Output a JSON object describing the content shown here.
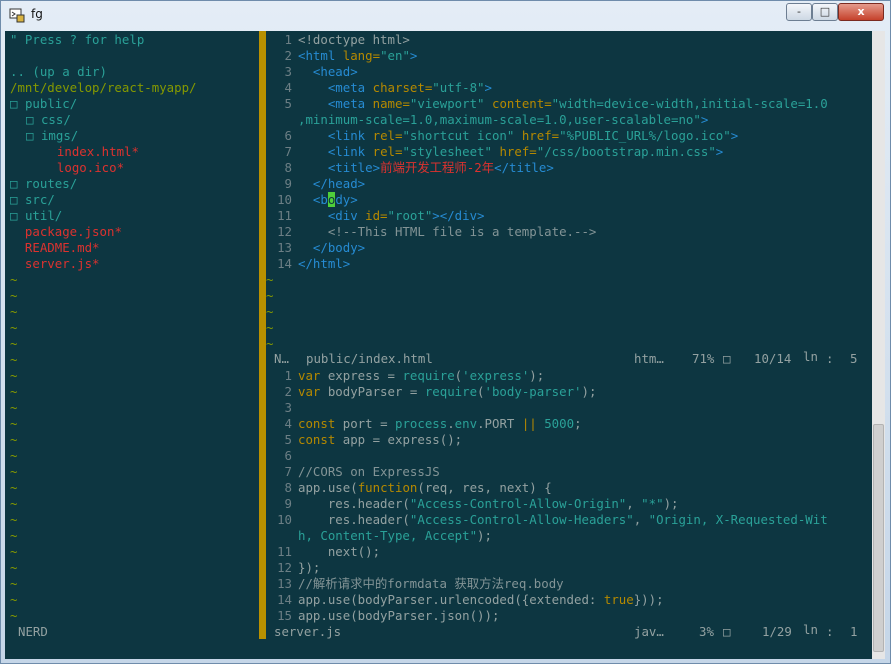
{
  "window": {
    "title": "fg",
    "buttons": [
      "-",
      "□",
      "x"
    ]
  },
  "icons": {
    "app": "terminal-tool-icon",
    "minimize": "minimize-icon",
    "maximize": "maximize-icon",
    "close": "close-icon"
  },
  "colors": {
    "background": "#0d3641",
    "tree_dir": "#2aa198",
    "tree_path": "#859900",
    "tree_file": "#dc322f",
    "separator": "#b89000",
    "text": "#93a1a1",
    "html_tag": "#268bd2",
    "string": "#2aa198",
    "keyword": "#b58900",
    "cursor": "#4fcf3a"
  },
  "nerdtree": {
    "help": "\" Press ? for help",
    "up": ".. (up a dir)",
    "path": "/mnt/develop/react-myapp/",
    "items": [
      {
        "indent": 0,
        "marker": "□",
        "name": "public/",
        "type": "dir"
      },
      {
        "indent": 1,
        "marker": "□",
        "name": "css/",
        "type": "dir"
      },
      {
        "indent": 1,
        "marker": "□",
        "name": "imgs/",
        "type": "dir"
      },
      {
        "indent": 2,
        "marker": "",
        "name": "index.html*",
        "type": "file"
      },
      {
        "indent": 2,
        "marker": "",
        "name": "logo.ico*",
        "type": "file"
      },
      {
        "indent": 0,
        "marker": "□",
        "name": "routes/",
        "type": "dir"
      },
      {
        "indent": 0,
        "marker": "□",
        "name": "src/",
        "type": "dir"
      },
      {
        "indent": 0,
        "marker": "□",
        "name": "util/",
        "type": "dir"
      },
      {
        "indent": 0,
        "marker": "",
        "name": "package.json*",
        "type": "file"
      },
      {
        "indent": 0,
        "marker": "",
        "name": "README.md*",
        "type": "file"
      },
      {
        "indent": 0,
        "marker": "",
        "name": "server.js*",
        "type": "file"
      }
    ],
    "tilde": "~",
    "statusline": "NERD"
  },
  "top_pane": {
    "lines": [
      {
        "n": "1",
        "segs": [
          [
            "<!doctype html>",
            "text"
          ]
        ]
      },
      {
        "n": "2",
        "segs": [
          [
            "<html ",
            "tag"
          ],
          [
            "lang=",
            "attr"
          ],
          [
            "\"en\"",
            "str"
          ],
          [
            ">",
            "tag"
          ]
        ]
      },
      {
        "n": "3",
        "segs": [
          [
            "  <head>",
            "tag"
          ]
        ]
      },
      {
        "n": "4",
        "segs": [
          [
            "    <meta ",
            "tag"
          ],
          [
            "charset=",
            "attr"
          ],
          [
            "\"utf-8\"",
            "str"
          ],
          [
            ">",
            "tag"
          ]
        ]
      },
      {
        "n": "5",
        "segs": [
          [
            "    <meta ",
            "tag"
          ],
          [
            "name=",
            "attr"
          ],
          [
            "\"viewport\" ",
            "str"
          ],
          [
            "content=",
            "attr"
          ],
          [
            "\"width=device-width,initial-scale=1.0",
            "str"
          ]
        ]
      },
      {
        "n": "",
        "segs": [
          [
            ",minimum-scale=1.0,maximum-scale=1.0,user-scalable=no\"",
            "str"
          ],
          [
            ">",
            "tag"
          ]
        ]
      },
      {
        "n": "6",
        "segs": [
          [
            "    <link ",
            "tag"
          ],
          [
            "rel=",
            "attr"
          ],
          [
            "\"shortcut icon\" ",
            "str"
          ],
          [
            "href=",
            "attr"
          ],
          [
            "\"%PUBLIC_URL%/logo.ico\"",
            "str"
          ],
          [
            ">",
            "tag"
          ]
        ]
      },
      {
        "n": "7",
        "segs": [
          [
            "    <link ",
            "tag"
          ],
          [
            "rel=",
            "attr"
          ],
          [
            "\"stylesheet\" ",
            "str"
          ],
          [
            "href=",
            "attr"
          ],
          [
            "\"/css/bootstrap.min.css\"",
            "str"
          ],
          [
            ">",
            "tag"
          ]
        ]
      },
      {
        "n": "8",
        "segs": [
          [
            "    <title>",
            "tag"
          ],
          [
            "前端开发工程师-2年",
            "red"
          ],
          [
            "</title>",
            "tag"
          ]
        ]
      },
      {
        "n": "9",
        "segs": [
          [
            "  </head>",
            "tag"
          ]
        ]
      },
      {
        "n": "10",
        "segs": [
          [
            "  <b",
            "tag"
          ],
          [
            "o",
            "cursor"
          ],
          [
            "dy>",
            "tag"
          ]
        ]
      },
      {
        "n": "11",
        "segs": [
          [
            "    <div ",
            "tag"
          ],
          [
            "id=",
            "attr"
          ],
          [
            "\"root\"",
            "str"
          ],
          [
            "></div>",
            "tag"
          ]
        ]
      },
      {
        "n": "12",
        "segs": [
          [
            "    <!--This HTML file is a template.-->",
            "comment"
          ]
        ]
      },
      {
        "n": "13",
        "segs": [
          [
            "  </body>",
            "tag"
          ]
        ]
      },
      {
        "n": "14",
        "segs": [
          [
            "</html>",
            "tag"
          ]
        ]
      }
    ],
    "tilde": "~",
    "status": {
      "mode": "N…",
      "file": "public/index.html",
      "filetype": "htm…",
      "percent": "71%",
      "marker": "□",
      "position": "10/14",
      "ln": "ln",
      "colon": ":",
      "col": "5"
    }
  },
  "bottom_pane": {
    "lines": [
      {
        "n": "1",
        "segs": [
          [
            "var ",
            "kw"
          ],
          [
            "express = ",
            "text"
          ],
          [
            "require",
            "func"
          ],
          [
            "(",
            "text"
          ],
          [
            "'express'",
            "str"
          ],
          [
            ");",
            "text"
          ]
        ]
      },
      {
        "n": "2",
        "segs": [
          [
            "var ",
            "kw"
          ],
          [
            "bodyParser = ",
            "text"
          ],
          [
            "require",
            "func"
          ],
          [
            "(",
            "text"
          ],
          [
            "'body-parser'",
            "str"
          ],
          [
            ");",
            "text"
          ]
        ]
      },
      {
        "n": "3",
        "segs": []
      },
      {
        "n": "4",
        "segs": [
          [
            "const ",
            "kw"
          ],
          [
            "port = ",
            "text"
          ],
          [
            "process",
            "func"
          ],
          [
            ".",
            "text"
          ],
          [
            "env",
            "func"
          ],
          [
            ".PORT ",
            "text"
          ],
          [
            "|| ",
            "kw"
          ],
          [
            "5000",
            "num"
          ],
          [
            ";",
            "text"
          ]
        ]
      },
      {
        "n": "5",
        "segs": [
          [
            "const ",
            "kw"
          ],
          [
            "app = express();",
            "text"
          ]
        ]
      },
      {
        "n": "6",
        "segs": []
      },
      {
        "n": "7",
        "segs": [
          [
            "//CORS on ExpressJS",
            "comment"
          ]
        ]
      },
      {
        "n": "8",
        "segs": [
          [
            "app.use(",
            "text"
          ],
          [
            "function",
            "kw"
          ],
          [
            "(req, res, next) {",
            "text"
          ]
        ]
      },
      {
        "n": "9",
        "segs": [
          [
            "    res.header(",
            "text"
          ],
          [
            "\"Access-Control-Allow-Origin\"",
            "str"
          ],
          [
            ", ",
            "text"
          ],
          [
            "\"*\"",
            "str"
          ],
          [
            ");",
            "text"
          ]
        ]
      },
      {
        "n": "10",
        "segs": [
          [
            "    res.header(",
            "text"
          ],
          [
            "\"Access-Control-Allow-Headers\"",
            "str"
          ],
          [
            ", ",
            "text"
          ],
          [
            "\"Origin, X-Requested-Wit",
            "str"
          ]
        ]
      },
      {
        "n": "",
        "segs": [
          [
            "h, Content-Type, Accept\"",
            "str"
          ],
          [
            ");",
            "text"
          ]
        ]
      },
      {
        "n": "11",
        "segs": [
          [
            "    next();",
            "text"
          ]
        ]
      },
      {
        "n": "12",
        "segs": [
          [
            "});",
            "text"
          ]
        ]
      },
      {
        "n": "13",
        "segs": [
          [
            "//解析请求中的formdata 获取方法req.body",
            "comment"
          ]
        ]
      },
      {
        "n": "14",
        "segs": [
          [
            "app.use(bodyParser.urlencoded({extended: ",
            "text"
          ],
          [
            "true",
            "kw"
          ],
          [
            "}));",
            "text"
          ]
        ]
      },
      {
        "n": "15",
        "segs": [
          [
            "app.use(bodyParser.json());",
            "text"
          ]
        ]
      }
    ],
    "status": {
      "file": "server.js",
      "filetype": "jav…",
      "percent": "3%",
      "marker": "□",
      "position": "1/29",
      "ln": "ln",
      "colon": ":",
      "col": "1"
    }
  }
}
